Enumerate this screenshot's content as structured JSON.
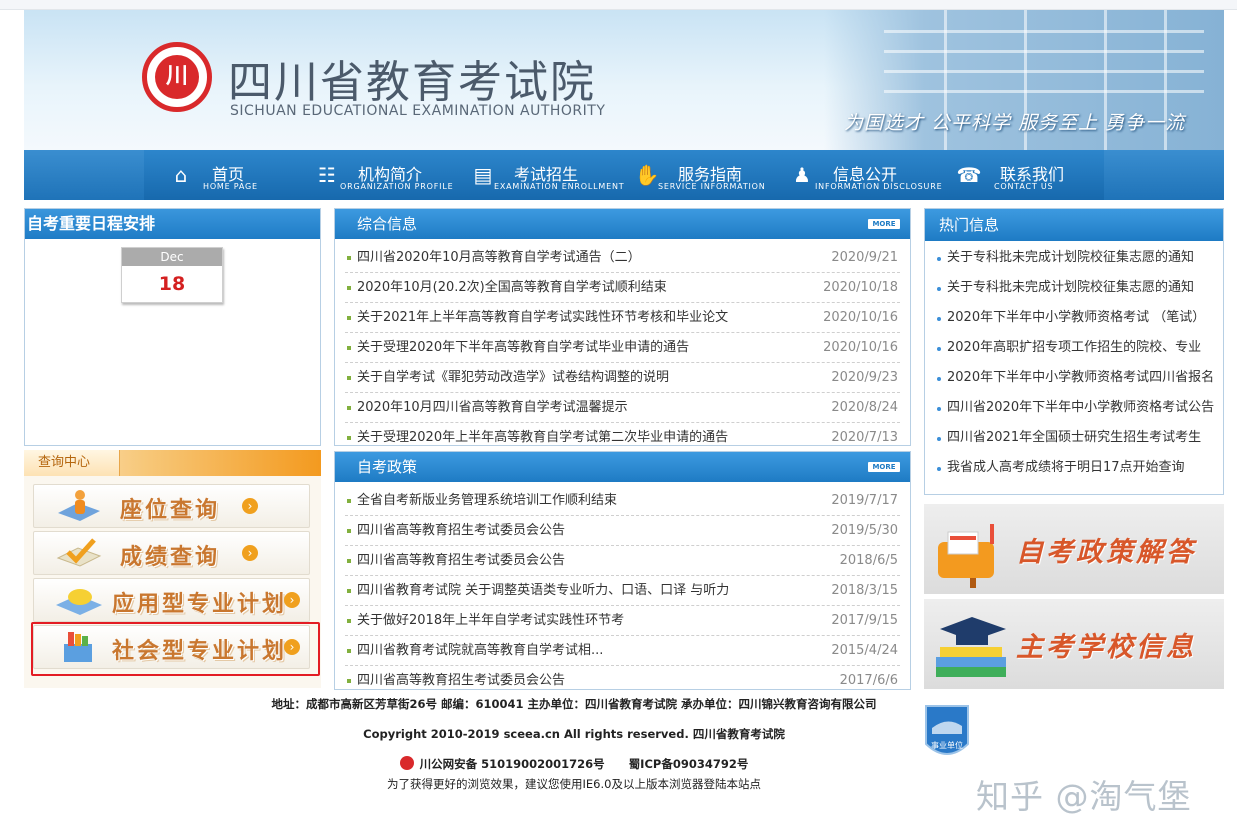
{
  "header": {
    "title": "四川省教育考试院",
    "subtitle": "SICHUAN EDUCATIONAL EXAMINATION AUTHORITY",
    "slogan": "为国选才 公平科学 服务至上 勇争一流"
  },
  "nav": [
    {
      "label": "首页",
      "en": "HOME PAGE",
      "icon": "home-icon"
    },
    {
      "label": "机构简介",
      "en": "ORGANIZATION PROFILE",
      "icon": "org-chart-icon"
    },
    {
      "label": "考试招生",
      "en": "EXAMINATION ENROLLMENT",
      "icon": "clipboard-icon"
    },
    {
      "label": "服务指南",
      "en": "SERVICE INFORMATION",
      "icon": "handshake-icon"
    },
    {
      "label": "信息公开",
      "en": "INFORMATION DISCLOSURE",
      "icon": "people-icon"
    },
    {
      "label": "联系我们",
      "en": "CONTACT US",
      "icon": "phone-icon"
    }
  ],
  "schedule": {
    "title": "自考重要日程安排",
    "month": "Dec",
    "day": "18"
  },
  "query": {
    "title": "查询中心",
    "buttons": [
      {
        "label": "座位查询",
        "icon": "seat-person-icon"
      },
      {
        "label": "成绩查询",
        "icon": "check-score-icon"
      },
      {
        "label": "应用型专业计划",
        "icon": "plan-hat-icon"
      },
      {
        "label": "社会型专业计划",
        "icon": "books-box-icon"
      }
    ]
  },
  "general": {
    "title": "综合信息",
    "more": "MORE",
    "items": [
      {
        "title": "四川省2020年10月高等教育自学考试通告（二）",
        "date": "2020/9/21"
      },
      {
        "title": "2020年10月(20.2次)全国高等教育自学考试顺利结束",
        "date": "2020/10/18"
      },
      {
        "title": "关于2021年上半年高等教育自学考试实践性环节考核和毕业论文",
        "date": "2020/10/16"
      },
      {
        "title": "关于受理2020年下半年高等教育自学考试毕业申请的通告",
        "date": "2020/10/16"
      },
      {
        "title": "关于自学考试《罪犯劳动改造学》试卷结构调整的说明",
        "date": "2020/9/23"
      },
      {
        "title": "2020年10月四川省高等教育自学考试温馨提示",
        "date": "2020/8/24"
      },
      {
        "title": "关于受理2020年上半年高等教育自学考试第二次毕业申请的通告",
        "date": "2020/7/13"
      }
    ]
  },
  "policy": {
    "title": "自考政策",
    "more": "MORE",
    "items": [
      {
        "title": "全省自考新版业务管理系统培训工作顺利结束",
        "date": "2019/7/17"
      },
      {
        "title": "四川省高等教育招生考试委员会公告",
        "date": "2019/5/30"
      },
      {
        "title": "四川省高等教育招生考试委员会公告",
        "date": "2018/6/5"
      },
      {
        "title": "四川省教育考试院 关于调整英语类专业听力、口语、口译 与听力",
        "date": "2018/3/15"
      },
      {
        "title": "关于做好2018年上半年自学考试实践性环节考",
        "date": "2017/9/15"
      },
      {
        "title": "四川省教育考试院就高等教育自学考试相...",
        "date": "2015/4/24"
      },
      {
        "title": "四川省高等教育招生考试委员会公告",
        "date": "2017/6/6"
      }
    ]
  },
  "hot": {
    "title": "热门信息",
    "items": [
      "关于专科批未完成计划院校征集志愿的通知",
      "关于专科批未完成计划院校征集志愿的通知",
      "2020年下半年中小学教师资格考试 （笔试）",
      "2020年高职扩招专项工作招生的院校、专业",
      "2020年下半年中小学教师资格考试四川省报名",
      "四川省2020年下半年中小学教师资格考试公告",
      "四川省2021年全国硕士研究生招生考试考生",
      "我省成人高考成绩将于明日17点开始查询"
    ]
  },
  "promos": [
    {
      "label": "自考政策解答",
      "icon": "mailbox-icon"
    },
    {
      "label": "主考学校信息",
      "icon": "graduation-books-icon"
    }
  ],
  "footer": {
    "address": "地址：成都市高新区芳草街26号 邮编：610041 主办单位：四川省教育考试院 承办单位：四川锦兴教育咨询有限公司",
    "copyright": "Copyright 2010-2019 sceea.cn All rights reserved. 四川省教育考试院",
    "police": "川公网安备 51019002001726号",
    "icp": "蜀ICP备09034792号",
    "browser": "为了获得更好的浏览效果，建议您使用IE6.0及以上版本浏览器登陆本站点",
    "badge": "事业单位"
  },
  "watermark": "知乎 @淘气堡",
  "colors": {
    "accent": "#1e7bc4",
    "highlight": "#e31c24",
    "date_red": "#d42020"
  }
}
